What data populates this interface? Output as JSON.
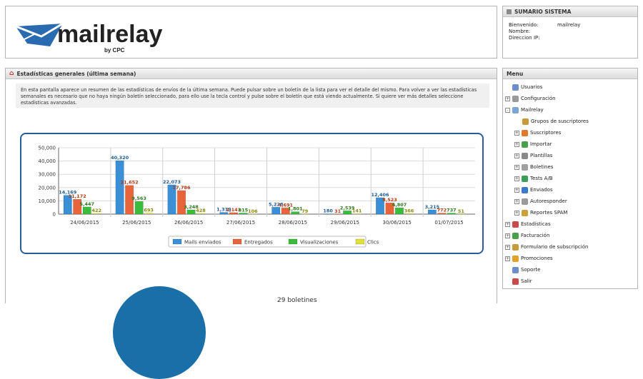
{
  "logo": {
    "brand": "mailrelay",
    "byline": "by CPC"
  },
  "summary": {
    "title": "SUMARIO SISTEMA",
    "rows": [
      {
        "label": "Bienvenido:",
        "value": "mailrelay"
      },
      {
        "label": "Nombre:",
        "value": ""
      },
      {
        "label": "Direccion IP:",
        "value": ""
      }
    ]
  },
  "stats": {
    "title": "Estadísticas generales (última semana)",
    "intro": "En esta pantalla aparece un resumen de las estadísticas de envíos de la última semana. Puede pulsar sobre un boletín de la lista para ver el detalle del mismo. Para volver a ver las estadísticas semanales es necesario que no haya ningún boletín seleccionado, para ello use la tecla control y pulse sobre el boletín que está viendo actualmente. Si quiere ver más detalles seleccione estadísticas avanzadas.",
    "bottom_label": "29 boletines"
  },
  "chart_data": {
    "type": "bar",
    "categories": [
      "24/06/2015",
      "25/06/2015",
      "26/06/2015",
      "27/06/2015",
      "28/06/2015",
      "29/06/2015",
      "30/06/2015",
      "01/07/2015"
    ],
    "yticks": [
      "0",
      "10,000",
      "20,000",
      "30,000",
      "40,000",
      "50,000"
    ],
    "ylim": [
      0,
      50000
    ],
    "series": [
      {
        "name": "Mails enviados",
        "color": "#3a8fd6",
        "label_color": "#1f5d94",
        "values": [
          14169,
          40320,
          22073,
          1319,
          5228,
          180,
          12406,
          3215
        ]
      },
      {
        "name": "Entregados",
        "color": "#e8643a",
        "label_color": "#b13a14",
        "values": [
          11172,
          21652,
          17786,
          1141,
          4691,
          31,
          8523,
          772
        ]
      },
      {
        "name": "Visualizaciones",
        "color": "#3cbc3c",
        "label_color": "#2d7a1e",
        "values": [
          5447,
          9563,
          3248,
          815,
          1801,
          2539,
          4807,
          737
        ]
      },
      {
        "name": "Clics",
        "color": "#e2e03a",
        "label_color": "#8a8a10",
        "values": [
          422,
          693,
          428,
          106,
          79,
          141,
          366,
          51
        ]
      }
    ],
    "data_labels": [
      [
        "14,169",
        "11,172",
        "5,447",
        "422"
      ],
      [
        "40,320",
        "21,652",
        "9,563",
        "693"
      ],
      [
        "22,073",
        "17,786",
        "3,248",
        "428"
      ],
      [
        "1,319",
        "1,141",
        "815",
        "106"
      ],
      [
        "5,228",
        "4,691",
        "1,801",
        "79"
      ],
      [
        "180",
        "31",
        "2,539",
        "141"
      ],
      [
        "12,406",
        "8,523",
        "4,807",
        "366"
      ],
      [
        "3,215",
        "772",
        "737",
        "51"
      ]
    ],
    "grid": true,
    "legend": "bottom"
  },
  "menu": {
    "title": "Menu",
    "items": [
      {
        "label": "Usuarios",
        "level": 0,
        "toggle": "",
        "icon": "users-icon",
        "color": "#6a8fc9"
      },
      {
        "label": "Configuración",
        "level": 0,
        "toggle": "+",
        "icon": "config-icon",
        "color": "#9a9a9a"
      },
      {
        "label": "Mailrelay",
        "level": 0,
        "toggle": "-",
        "icon": "mailrelay-icon",
        "color": "#7aa7d6"
      },
      {
        "label": "Grupos de suscriptores",
        "level": 2,
        "toggle": "",
        "icon": "groups-icon",
        "color": "#c49a3a"
      },
      {
        "label": "Suscriptores",
        "level": 1,
        "toggle": "+",
        "icon": "subscribers-icon",
        "color": "#e07a2a"
      },
      {
        "label": "Importar",
        "level": 1,
        "toggle": "+",
        "icon": "import-icon",
        "color": "#4aa04a"
      },
      {
        "label": "Plantillas",
        "level": 1,
        "toggle": "+",
        "icon": "templates-icon",
        "color": "#8a8a8a"
      },
      {
        "label": "Boletines",
        "level": 1,
        "toggle": "+",
        "icon": "newsletters-icon",
        "color": "#a0a0a0"
      },
      {
        "label": "Tests A/B",
        "level": 1,
        "toggle": "+",
        "icon": "ab-tests-icon",
        "color": "#3aa05a"
      },
      {
        "label": "Enviados",
        "level": 1,
        "toggle": "+",
        "icon": "sent-icon",
        "color": "#3a7ac9"
      },
      {
        "label": "Autoresponder",
        "level": 1,
        "toggle": "+",
        "icon": "autoresponder-icon",
        "color": "#9a9a9a"
      },
      {
        "label": "Reportes SPAM",
        "level": 1,
        "toggle": "+",
        "icon": "spam-reports-icon",
        "color": "#c9a03a"
      },
      {
        "label": "Estadísticas",
        "level": 0,
        "toggle": "+",
        "icon": "statistics-icon",
        "color": "#c94a4a"
      },
      {
        "label": "Facturación",
        "level": 0,
        "toggle": "+",
        "icon": "billing-icon",
        "color": "#4aa04a"
      },
      {
        "label": "Formulario de subscripción",
        "level": 0,
        "toggle": "+",
        "icon": "form-icon",
        "color": "#c99a3a"
      },
      {
        "label": "Promociones",
        "level": 0,
        "toggle": "+",
        "icon": "promotions-icon",
        "color": "#e0a02a"
      },
      {
        "label": "Soporte",
        "level": 0,
        "toggle": "",
        "icon": "support-icon",
        "color": "#6a8fc9"
      },
      {
        "label": "Salir",
        "level": 0,
        "toggle": "",
        "icon": "logout-icon",
        "color": "#c94a4a"
      }
    ]
  }
}
